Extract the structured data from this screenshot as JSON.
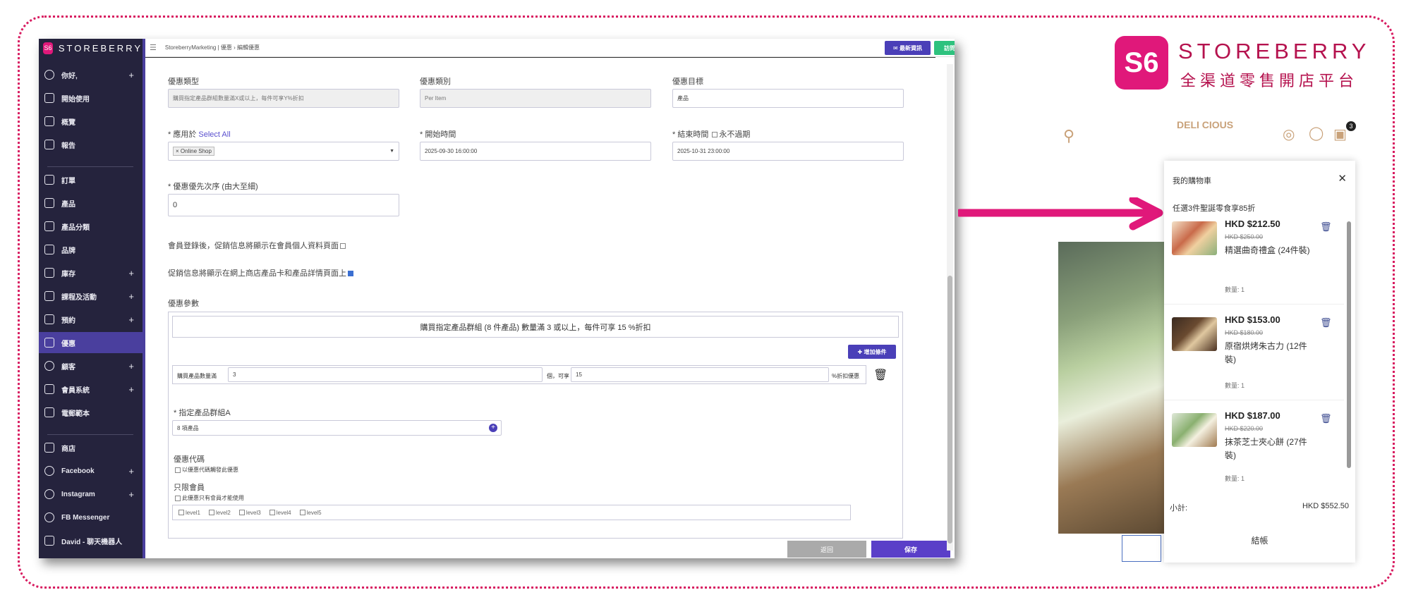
{
  "admin": {
    "brand": "STOREBERRY",
    "sidebar": [
      {
        "label": "你好,",
        "plus": "+"
      },
      {
        "label": "開始使用",
        "plus": ""
      },
      {
        "label": "概覽",
        "plus": ""
      },
      {
        "label": "報告",
        "plus": ""
      },
      {
        "label": "訂單",
        "plus": ""
      },
      {
        "label": "產品",
        "plus": ""
      },
      {
        "label": "產品分類",
        "plus": ""
      },
      {
        "label": "品牌",
        "plus": ""
      },
      {
        "label": "庫存",
        "plus": "+"
      },
      {
        "label": "課程及活動",
        "plus": "+"
      },
      {
        "label": "預約",
        "plus": "+"
      },
      {
        "label": "優惠",
        "plus": ""
      },
      {
        "label": "顧客",
        "plus": "+"
      },
      {
        "label": "會員系統",
        "plus": "+"
      },
      {
        "label": "電郵範本",
        "plus": ""
      },
      {
        "label": "商店",
        "plus": ""
      },
      {
        "label": "Facebook",
        "plus": "+"
      },
      {
        "label": "Instagram",
        "plus": "+"
      },
      {
        "label": "FB Messenger",
        "plus": ""
      },
      {
        "label": "David - 聊天機器人",
        "plus": ""
      }
    ],
    "breadcrumb": "StoreberryMarketing  |  優惠  ›  編輯優惠",
    "btn_new_feature": "✉ 最新資訊",
    "btn_visit_store": "訪問您的商店",
    "form": {
      "type_label": "優惠類型",
      "type_value": "購買指定產品群組數量滿X或以上，每件可享Y%折扣",
      "category_label": "優惠類別",
      "category_value": "Per Item",
      "target_label": "優惠目標",
      "target_value": "產品",
      "apply_label": "* 應用於",
      "select_all": "Select All",
      "apply_tag": "× Online Shop",
      "start_label": "* 開始時間",
      "start_value": "2025-09-30 16:00:00",
      "end_label": "* 結束時間",
      "never_expire": "永不過期",
      "end_value": "2025-10-31 23:00:00",
      "priority_label": "* 優惠優先次序 (由大至細)",
      "priority_value": "0",
      "member_show": "會員登錄後，促銷信息將顯示在會員個人資料頁面",
      "product_show": "促銷信息將顯示在網上商店產品卡和產品詳情頁面上",
      "params_label": "優惠參數",
      "summary": "購買指定產品群組 (8 件產品) 數量滿 3 或以上，每件可享 15 %折扣",
      "add_condition": "✚ 增加條件",
      "qty_label": "購買產品數量滿",
      "qty_value": "3",
      "qty_suffix": "個，可享",
      "pct_value": "15",
      "pct_suffix": "%折扣優惠",
      "group_label": "* 指定產品群組A",
      "group_value": "8 項產品",
      "code_label": "優惠代碼",
      "code_check": "以優惠代碼觸發此優惠",
      "members_only_label": "只限會員",
      "members_only_check": "此優惠只有會員才能使用",
      "levels": [
        "level1",
        "level2",
        "level3",
        "level4",
        "level5"
      ],
      "btn_back": "返回",
      "btn_save": "保存"
    }
  },
  "store": {
    "brand_title": "STOREBERRY",
    "brand_subtitle": "全渠道零售開店平台",
    "logo_text": "DELI CIOUS",
    "cart_count": "3",
    "cart": {
      "title": "我的購物車",
      "promo": "任選3件聖誕零食享85折",
      "items": [
        {
          "price": "HKD $212.50",
          "old_price": "HKD $250.00",
          "name": "精選曲奇禮盒 (24件裝)",
          "qty": "數量: 1"
        },
        {
          "price": "HKD $153.00",
          "old_price": "HKD $180.00",
          "name": "原宿烘烤朱古力 (12件裝)",
          "qty": "數量: 1"
        },
        {
          "price": "HKD $187.00",
          "old_price": "HKD $220.00",
          "name": "抹茶芝士夾心餅 (27件裝)",
          "qty": "數量: 1"
        }
      ],
      "subtotal_label": "小計:",
      "subtotal_value": "HKD $552.50",
      "checkout": "結帳"
    }
  },
  "colors": {
    "accent": "#4a3f9e",
    "brand": "#e0187a",
    "arrow": "#e0187a"
  }
}
